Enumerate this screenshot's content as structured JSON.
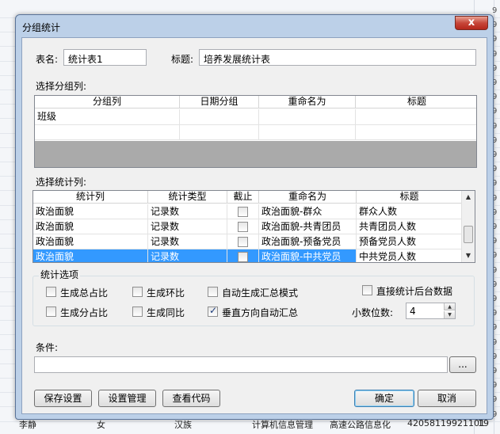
{
  "dialog": {
    "title": "分组统计",
    "close_symbol": "x"
  },
  "table_name": {
    "label": "表名:",
    "value": "统计表1"
  },
  "caption": {
    "label": "标题:",
    "value": "培养发展统计表"
  },
  "group_section": {
    "label": "选择分组列:",
    "headers": [
      "分组列",
      "日期分组",
      "重命名为",
      "标题"
    ],
    "rows": [
      [
        "班级",
        "",
        "",
        ""
      ],
      [
        "",
        "",
        "",
        ""
      ]
    ]
  },
  "stat_section": {
    "label": "选择统计列:",
    "headers": [
      "统计列",
      "统计类型",
      "截止",
      "重命名为",
      "标题"
    ],
    "rows": [
      {
        "col": "政治面貌",
        "type": "记录数",
        "cutoff": false,
        "rename": "政治面貌-群众",
        "title": "群众人数",
        "selected": false
      },
      {
        "col": "政治面貌",
        "type": "记录数",
        "cutoff": false,
        "rename": "政治面貌-共青团员",
        "title": "共青团员人数",
        "selected": false
      },
      {
        "col": "政治面貌",
        "type": "记录数",
        "cutoff": false,
        "rename": "政治面貌-预备党员",
        "title": "预备党员人数",
        "selected": false
      },
      {
        "col": "政治面貌",
        "type": "记录数",
        "cutoff": false,
        "rename": "政治面貌-中共党员",
        "title": "中共党员人数",
        "selected": true
      }
    ]
  },
  "options": {
    "title": "统计选项",
    "total_ratio": {
      "label": "生成总占比",
      "checked": false
    },
    "chain_ratio": {
      "label": "生成环比",
      "checked": false
    },
    "auto_summary": {
      "label": "自动生成汇总模式",
      "checked": false
    },
    "direct_backend": {
      "label": "直接统计后台数据",
      "checked": false
    },
    "sub_ratio": {
      "label": "生成分占比",
      "checked": false
    },
    "yoy_ratio": {
      "label": "生成同比",
      "checked": false
    },
    "vertical_summary": {
      "label": "垂直方向自动汇总",
      "checked": true
    },
    "decimals": {
      "label": "小数位数:",
      "value": "4"
    }
  },
  "condition": {
    "label": "条件:",
    "value": "",
    "browse_label": "..."
  },
  "buttons": {
    "save_settings": "保存设置",
    "manage_settings": "设置管理",
    "view_code": "查看代码",
    "ok": "确定",
    "cancel": "取消"
  },
  "background": {
    "row_numbers": [
      "9",
      "9",
      "9",
      "9",
      "9",
      "9",
      "9",
      "9",
      "9",
      "9",
      "9",
      "9",
      "9",
      "9",
      "9",
      "9",
      "9",
      "9",
      "9",
      "9",
      "9",
      "9",
      "9",
      "9",
      "9",
      "9",
      "9",
      "9",
      "9"
    ],
    "bottom_row": [
      "李静",
      "女",
      "汉族",
      "计算机信息管理",
      "高速公路信息化",
      "42058119921101",
      "19"
    ]
  }
}
